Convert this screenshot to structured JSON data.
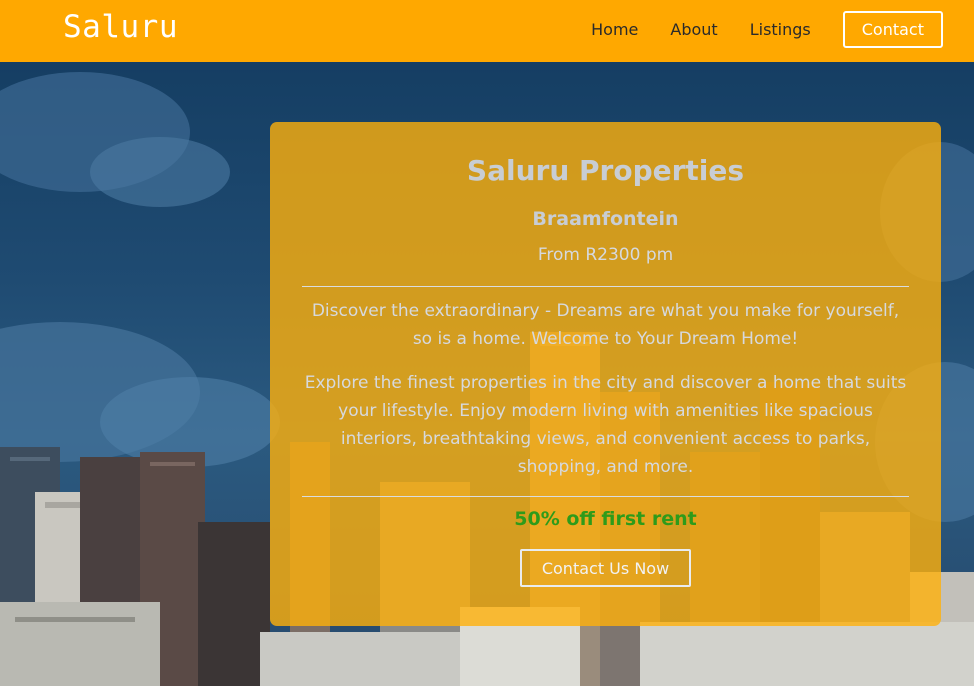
{
  "navbar": {
    "brand": "Saluru",
    "links": [
      "Home",
      "About",
      "Listings"
    ],
    "contact_label": "Contact",
    "background_color": "#ffa800"
  },
  "hero": {
    "title": "Saluru Properties",
    "location": "Braamfontein",
    "price": "From R2300 pm",
    "intro": "Discover the extraordinary - Dreams are what you make for yourself, so is a home. Welcome to Your Dream Home!",
    "description": "Explore the finest properties in the city and discover a home that suits your lifestyle. Enjoy modern living with amenities like spacious interiors, breathtaking views, and convenient access to parks, shopping, and more.",
    "offer": "50% off first rent",
    "cta_label": "Contact Us Now",
    "offer_color": "#2e9b1a"
  }
}
